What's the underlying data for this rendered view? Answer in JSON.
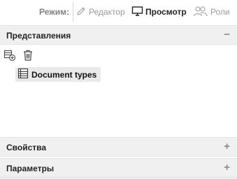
{
  "toolbar": {
    "mode_label": "Режим:",
    "modes": [
      {
        "label": "Редактор",
        "icon": "pencil-icon",
        "active": false
      },
      {
        "label": "Просмотр",
        "icon": "monitor-icon",
        "active": true
      },
      {
        "label": "Роли",
        "icon": "users-icon",
        "active": false
      }
    ]
  },
  "panels": {
    "views": {
      "title": "Представления",
      "toggle": "−",
      "actions": [
        {
          "name": "add-view",
          "icon": "add-list-icon"
        },
        {
          "name": "delete-view",
          "icon": "trash-icon"
        }
      ],
      "items": [
        {
          "label": "Document types",
          "icon": "table-icon",
          "selected": true
        }
      ]
    },
    "properties": {
      "title": "Свойства",
      "toggle": "+"
    },
    "parameters": {
      "title": "Параметры",
      "toggle": "+"
    }
  },
  "colors": {
    "header_bg": "#f0f0f0",
    "selected_bg": "#e9e9e9",
    "muted_text": "#9a9a9a"
  }
}
